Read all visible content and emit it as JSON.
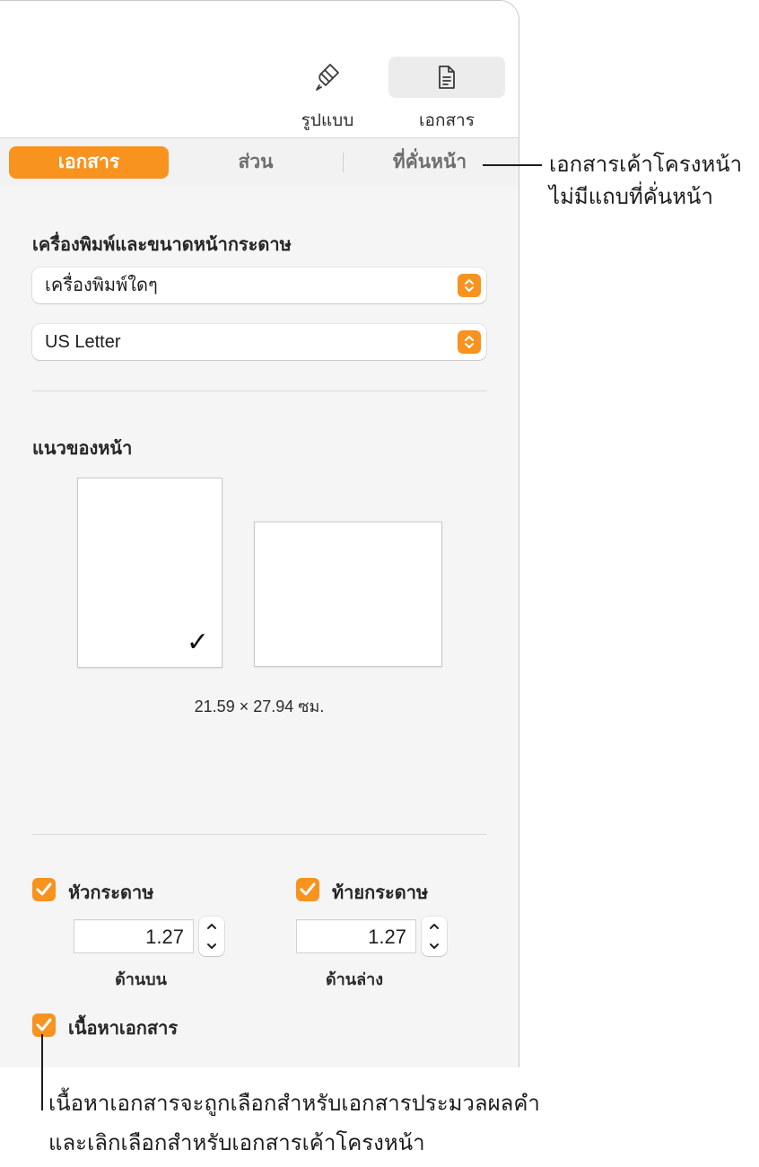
{
  "toolbar": {
    "format_label": "รูปแบบ",
    "document_label": "เอกสาร"
  },
  "tabs": [
    {
      "label": "เอกสาร",
      "active": true
    },
    {
      "label": "ส่วน",
      "active": false
    },
    {
      "label": "ที่คั่นหน้า",
      "active": false
    }
  ],
  "printer_section": {
    "title": "เครื่องพิมพ์และขนาดหน้ากระดาษ",
    "printer_value": "เครื่องพิมพ์ใดๆ",
    "paper_value": "US Letter"
  },
  "orientation_section": {
    "title": "แนวของหน้า",
    "selected": "portrait",
    "checkmark": "✓",
    "page_size": "21.59 × 27.94 ซม."
  },
  "header_footer": {
    "header": {
      "label": "หัวกระดาษ",
      "checked": true,
      "value": "1.27",
      "caption": "ด้านบน"
    },
    "footer": {
      "label": "ท้ายกระดาษ",
      "checked": true,
      "value": "1.27",
      "caption": "ด้านล่าง"
    }
  },
  "document_body": {
    "label": "เนื้อหาเอกสาร",
    "checked": true
  },
  "callouts": {
    "bookmarks_line1": "เอกสารเค้าโครงหน้า",
    "bookmarks_line2": "ไม่มีแถบที่คั่นหน้า",
    "body_line1": "เนื้อหาเอกสารจะถูกเลือกสำหรับเอกสารประมวลผลคำ",
    "body_line2": "และเลิกเลือกสำหรับเอกสารเค้าโครงหน้า"
  },
  "colors": {
    "accent": "#f7931e",
    "panel_bg": "#f5f5f5",
    "text": "#1d1d1f"
  }
}
